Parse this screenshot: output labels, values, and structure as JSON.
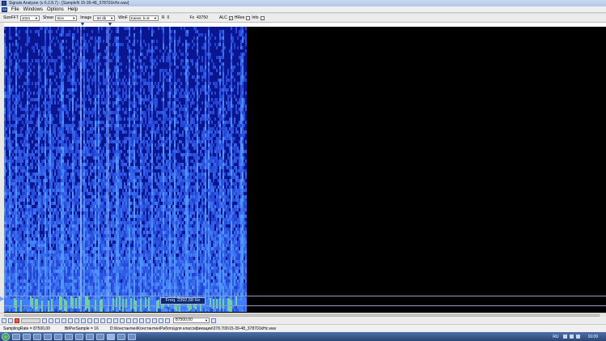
{
  "window": {
    "title": "Signals Analyzer (v 6.2.8.7) - [SampleN 15-39-48_378701kHz.wav]"
  },
  "menu": {
    "items": [
      "File",
      "Windows",
      "Options",
      "Help"
    ]
  },
  "toolbar": {
    "size_fft_label": "SizeFFT",
    "size_fft_value": "1024",
    "shear_label": "Shear",
    "shear_value": "Size",
    "image_label": "Image",
    "image_value": "- 50 db",
    "winf_label": "WinF",
    "winf_value": "Kaiser, b=8",
    "r_label": "R",
    "r_value": "0",
    "fs_label": "Fs",
    "fs_value": "43750",
    "alc_label": "ALC",
    "alc_checked": "✓",
    "hres_label": "HRes",
    "info_label": "Info"
  },
  "spectrogram": {
    "frequency_readout": "Freq. 2392,58 Hz",
    "colors": {
      "background": "#000000",
      "low": "#0a1aa0",
      "high": "#4a7dff"
    }
  },
  "bottom_toolbar": {
    "sample_rate_value": "87500,00"
  },
  "statusbar": {
    "sampling_rate": "SamplingRate = 87500,00",
    "bits_per_sample": "BitPerSample = 16",
    "file_path": "D:\\Константин\\Константин\\Работа\\для классификации\\378.700\\15-39-48_378701kHz.wav"
  },
  "taskbar": {
    "language": "RU",
    "clock": "16:09"
  }
}
